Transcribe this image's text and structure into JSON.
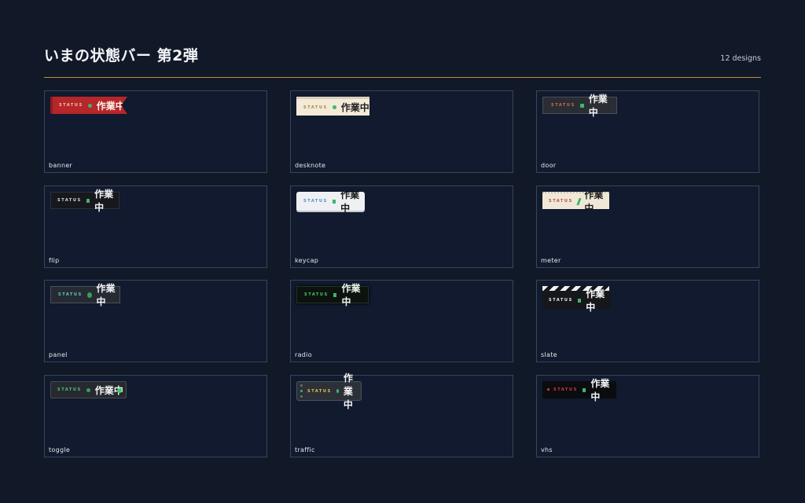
{
  "header": {
    "title": "いまの状態バー 第2弾",
    "count": "12 designs"
  },
  "badge": {
    "status_label": "STATUS",
    "value": "作業中"
  },
  "designs": [
    {
      "name": "banner"
    },
    {
      "name": "desknote"
    },
    {
      "name": "door"
    },
    {
      "name": "flip"
    },
    {
      "name": "keycap"
    },
    {
      "name": "meter"
    },
    {
      "name": "panel"
    },
    {
      "name": "radio"
    },
    {
      "name": "slate"
    },
    {
      "name": "toggle"
    },
    {
      "name": "traffic"
    },
    {
      "name": "vhs"
    }
  ],
  "colors": {
    "background": "#111827",
    "accent_rule": "#b8923e",
    "status_green": "#3fb56a"
  }
}
